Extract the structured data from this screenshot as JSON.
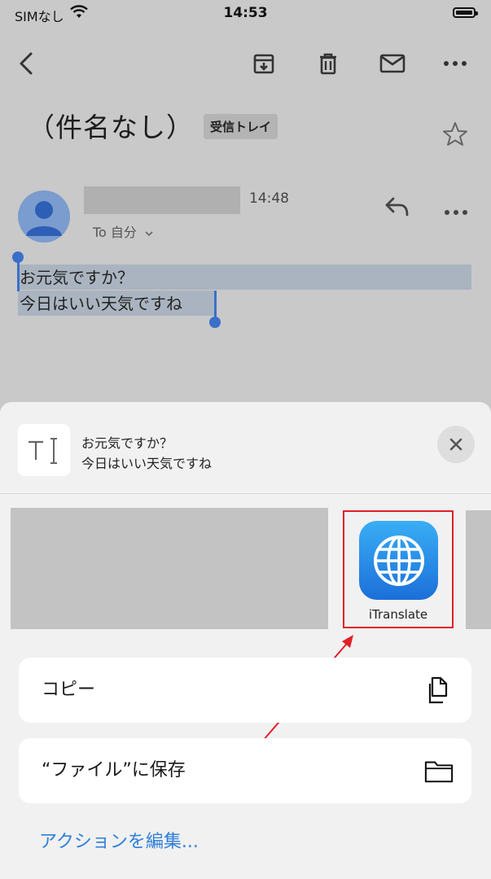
{
  "status": {
    "carrier": "SIMなし",
    "time": "14:53"
  },
  "email": {
    "subject": "（件名なし）",
    "label": "受信トレイ",
    "time": "14:48",
    "to": "To 自分",
    "body_line1": "お元気ですか？",
    "body_line2": "今日はいい天気ですね"
  },
  "share": {
    "preview_line1": "お元気ですか？",
    "preview_line2": "今日はいい天気ですね",
    "app_label": "iTranslate",
    "action_copy": "コピー",
    "action_save": "“ファイル”に保存",
    "edit_actions": "アクションを編集..."
  },
  "colors": {
    "accent": "#2f7fd8",
    "highlight": "#e0202a",
    "selection": "#3c6fc8"
  }
}
